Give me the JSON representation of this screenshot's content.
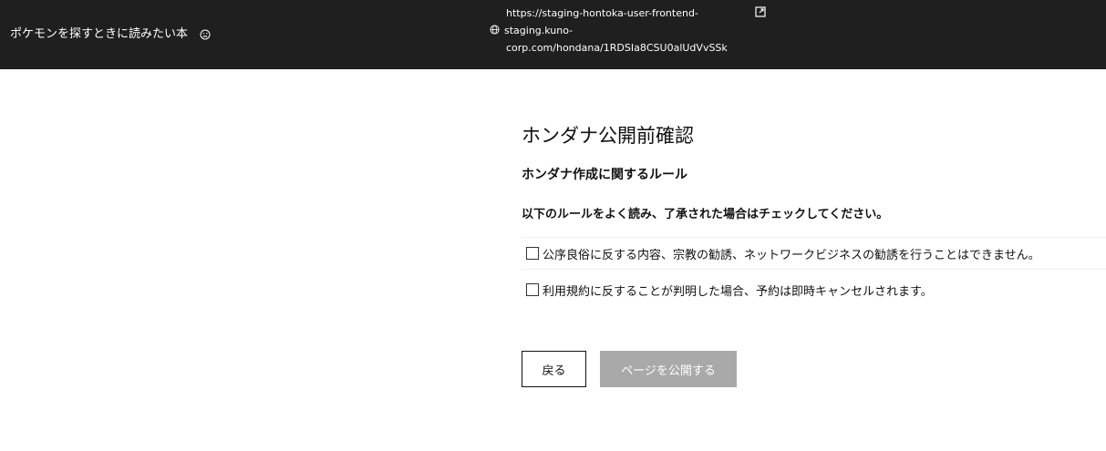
{
  "header": {
    "page_name": "ポケモンを探すときに読みたい本",
    "url_lines": [
      "https://staging-hontoka-user-frontend-",
      "staging.kuno-",
      "corp.com/hondana/1RDSIa8CSU0alUdVvSSk"
    ],
    "icons": {
      "status": "frown-face-icon",
      "globe": "globe-icon",
      "external": "external-link-icon"
    }
  },
  "main": {
    "title": "ホンダナ公開前確認",
    "subtitle": "ホンダナ作成に関するルール",
    "instruction": "以下のルールをよく読み、了承された場合はチェックしてください。",
    "rules": [
      {
        "label": "公序良俗に反する内容、宗教の勧誘、ネットワークビジネスの勧誘を行うことはできません。",
        "checked": false
      },
      {
        "label": "利用規約に反することが判明した場合、予約は即時キャンセルされます。",
        "checked": false
      }
    ]
  },
  "actions": {
    "back_label": "戻る",
    "publish_label": "ページを公開する",
    "publish_disabled": true
  },
  "colors": {
    "topbar_bg": "#1f1f1f",
    "disabled_button_bg": "#a9a9a9"
  }
}
